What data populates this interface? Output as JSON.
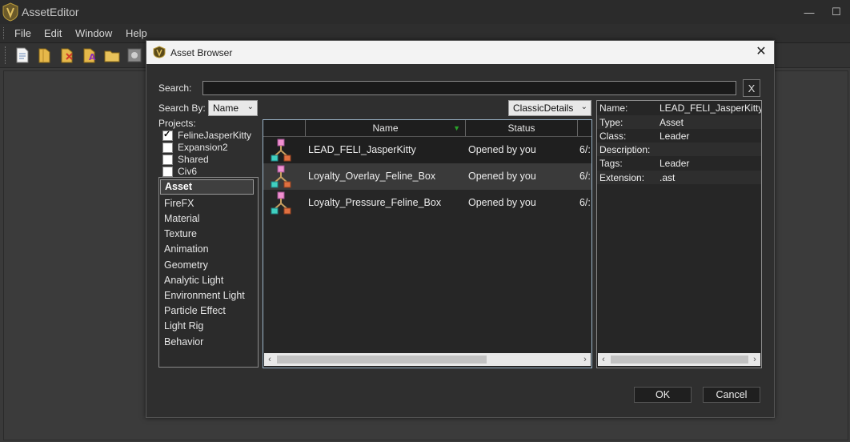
{
  "app": {
    "title": "AssetEditor"
  },
  "window_controls": {
    "minimize": "—",
    "maximize": "☐"
  },
  "menu": [
    "File",
    "Edit",
    "Window",
    "Help"
  ],
  "toolbar_icons": [
    "new-document-icon",
    "open-icon",
    "remove-icon",
    "rename-icon",
    "folder-icon",
    "settings-icon"
  ],
  "dialog": {
    "title": "Asset Browser",
    "close_glyph": "✕",
    "search_label": "Search:",
    "search_value": "",
    "clear_button": "X",
    "search_by_label": "Search By:",
    "search_by_value": "Name",
    "view_mode_value": "ClassicDetails",
    "projects_label": "Projects:",
    "projects": [
      {
        "name": "FelineJasperKitty",
        "checked": true
      },
      {
        "name": "Expansion2",
        "checked": false
      },
      {
        "name": "Shared",
        "checked": false
      },
      {
        "name": "Civ6",
        "checked": false
      }
    ],
    "asset_types": [
      "Asset",
      "FireFX",
      "Material",
      "Texture",
      "Animation",
      "Geometry",
      "Analytic Light",
      "Environment Light",
      "Particle Effect",
      "Light Rig",
      "Behavior"
    ],
    "selected_type": "Asset",
    "columns": [
      "Name",
      "Status"
    ],
    "rows": [
      {
        "name": "LEAD_FELI_JasperKitty",
        "status": "Opened by you",
        "date": "6/:"
      },
      {
        "name": "Loyalty_Overlay_Feline_Box",
        "status": "Opened by you",
        "date": "6/:"
      },
      {
        "name": "Loyalty_Pressure_Feline_Box",
        "status": "Opened by you",
        "date": "6/:"
      }
    ],
    "properties": [
      {
        "key": "Name:",
        "value": "LEAD_FELI_JasperKitty"
      },
      {
        "key": "Type:",
        "value": "Asset"
      },
      {
        "key": "Class:",
        "value": "Leader"
      },
      {
        "key": "Description:",
        "value": ""
      },
      {
        "key": "Tags:",
        "value": "Leader"
      },
      {
        "key": "Extension:",
        "value": ".ast"
      }
    ],
    "ok_button": "OK",
    "cancel_button": "Cancel"
  },
  "colors": {
    "dialog_bg": "#2f2f2f",
    "title_bg": "#f3f3f3",
    "grid_border": "#9bb4c8",
    "sort_arrow": "#2aa32a"
  }
}
